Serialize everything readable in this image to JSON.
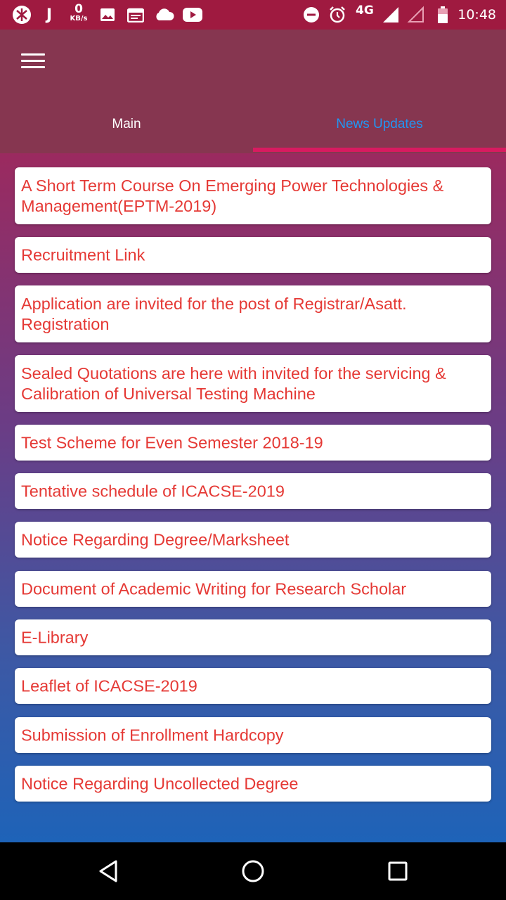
{
  "status_bar": {
    "time": "10:48",
    "data_speed_value": "0",
    "data_speed_unit": "KB/s",
    "network_type": "4G",
    "icons": [
      "app-logo-icon",
      "jio-icon",
      "image-icon",
      "calendar-icon",
      "cloud-icon",
      "youtube-icon",
      "do-not-disturb-icon",
      "alarm-icon",
      "signal-icon",
      "signal-empty-icon",
      "battery-icon"
    ]
  },
  "app_bar": {
    "menu_icon": "hamburger-menu-icon"
  },
  "tabs": [
    {
      "label": "Main",
      "selected": false
    },
    {
      "label": "News Updates",
      "selected": true
    }
  ],
  "colors": {
    "status_bar": "#9f1a40",
    "app_bar": "#863650",
    "tab_selected_text": "#2196f3",
    "tab_indicator": "#d81b60",
    "card_text": "#e53935"
  },
  "news_items": [
    "A Short Term Course On Emerging  Power Technologies & Management(EPTM-2019)",
    "Recruitment Link",
    "Application are  invited for the post of Registrar/Asatt. Registration",
    "Sealed Quotations are here with invited for the servicing & Calibration of Universal Testing Machine",
    "Test Scheme for Even Semester 2018-19",
    "Tentative schedule of ICACSE-2019",
    "Notice Regarding Degree/Marksheet",
    "Document of Academic Writing for Research Scholar",
    "E-Library",
    "Leaflet of ICACSE-2019",
    "Submission of Enrollment Hardcopy",
    "Notice Regarding Uncollected Degree"
  ],
  "nav_bar": {
    "buttons": [
      "back-icon",
      "home-icon",
      "recents-icon"
    ]
  }
}
